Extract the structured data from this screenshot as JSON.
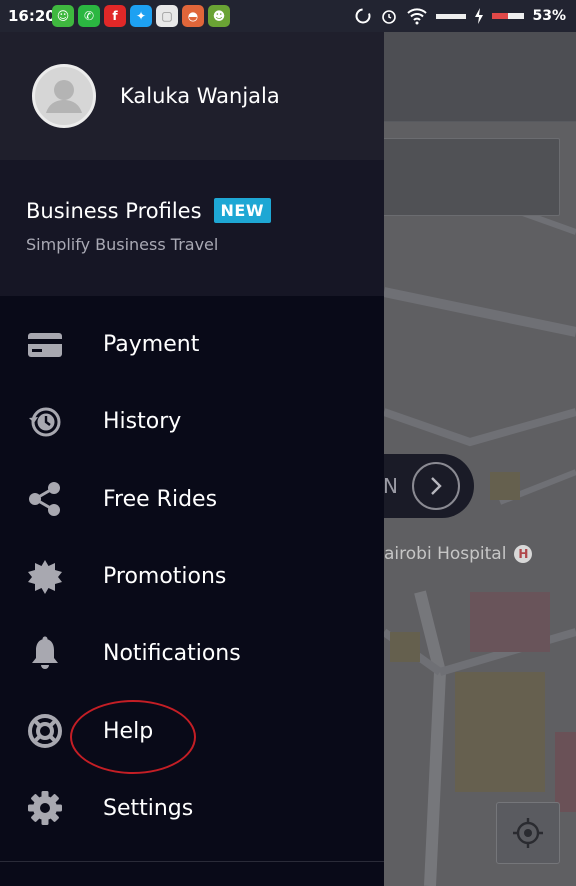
{
  "status_bar": {
    "time": "16:20",
    "battery": "53%",
    "notification_icons": [
      {
        "name": "wechat-icon",
        "color": "#3fb83f"
      },
      {
        "name": "whatsapp-icon",
        "color": "#2bb741"
      },
      {
        "name": "flipboard-icon",
        "color": "#e12828"
      },
      {
        "name": "twitter-icon",
        "color": "#1da1f2"
      },
      {
        "name": "gallery-icon",
        "color": "#e8e8e8"
      },
      {
        "name": "game-icon",
        "color": "#e0663a"
      },
      {
        "name": "monkey-icon",
        "color": "#6aa334"
      }
    ]
  },
  "drawer": {
    "user_name": "Kaluka Wanjala",
    "business": {
      "title": "Business Profiles",
      "badge": "NEW",
      "subtitle": "Simplify Business Travel"
    },
    "menu": [
      {
        "label": "Payment",
        "icon": "credit-card-icon"
      },
      {
        "label": "History",
        "icon": "history-icon"
      },
      {
        "label": "Free Rides",
        "icon": "share-icon"
      },
      {
        "label": "Promotions",
        "icon": "promotions-badge-icon"
      },
      {
        "label": "Notifications",
        "icon": "bell-icon"
      },
      {
        "label": "Help",
        "icon": "lifebuoy-icon"
      },
      {
        "label": "Settings",
        "icon": "gear-icon"
      }
    ]
  },
  "map": {
    "pill_text": "N",
    "hospital": "airobi Hospital",
    "hospital_badge": "H"
  },
  "colors": {
    "drawer_bg": "#090a18",
    "badge_blue": "#1ea7d4",
    "annotation_red": "#c41e25"
  }
}
